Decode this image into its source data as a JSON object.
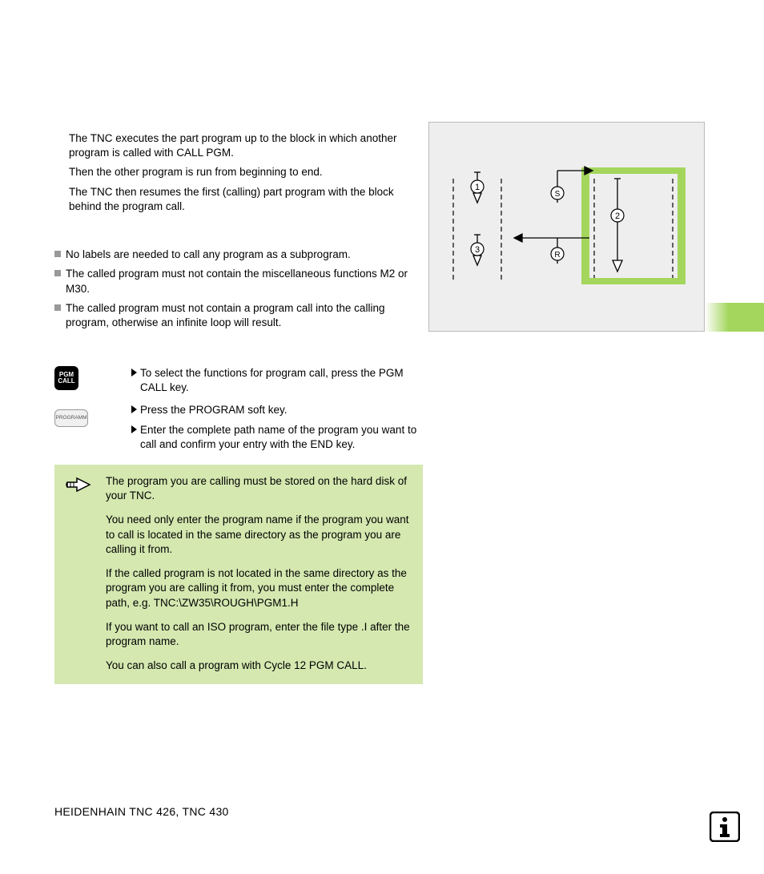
{
  "intro": {
    "p1": "The TNC executes the part program up to the block in which another program is called with CALL PGM.",
    "p2": "Then the other program is run from beginning to end.",
    "p3": "The TNC then resumes the first (calling) part program with the block behind the program call."
  },
  "bullets": [
    "No labels are needed to call any program as a subprogram.",
    "The called program must not contain the miscellaneous functions M2 or M30.",
    "The called program must not contain a program call into the calling program, otherwise an infinite loop will result."
  ],
  "keys": {
    "pgm_call_l1": "PGM",
    "pgm_call_l2": "CALL",
    "programm": "PROGRAMM"
  },
  "instr": [
    "To select the functions for program call, press the PGM CALL key.",
    "Press the PROGRAM soft key.",
    "Enter the complete path name of the program you want to call and confirm your entry with the END key."
  ],
  "note": {
    "p1": "The program you are calling must be stored on the hard disk of your TNC.",
    "p2": "You need only enter the program name if the program you want to call is located in the same directory as the program you are calling it from.",
    "p3": "If the called program is not located in the same directory as the program you are calling it from, you must enter the complete path, e.g. TNC:\\ZW35\\ROUGH\\PGM1.H",
    "p4": "If you want to call an ISO program, enter the file type .I after the program name.",
    "p5": "You can also call a program with Cycle 12 PGM CALL."
  },
  "diagram": {
    "labels": {
      "n1": "1",
      "n2": "2",
      "n3": "3",
      "s": "S",
      "r": "R"
    }
  },
  "footer": "HEIDENHAIN TNC 426, TNC 430"
}
